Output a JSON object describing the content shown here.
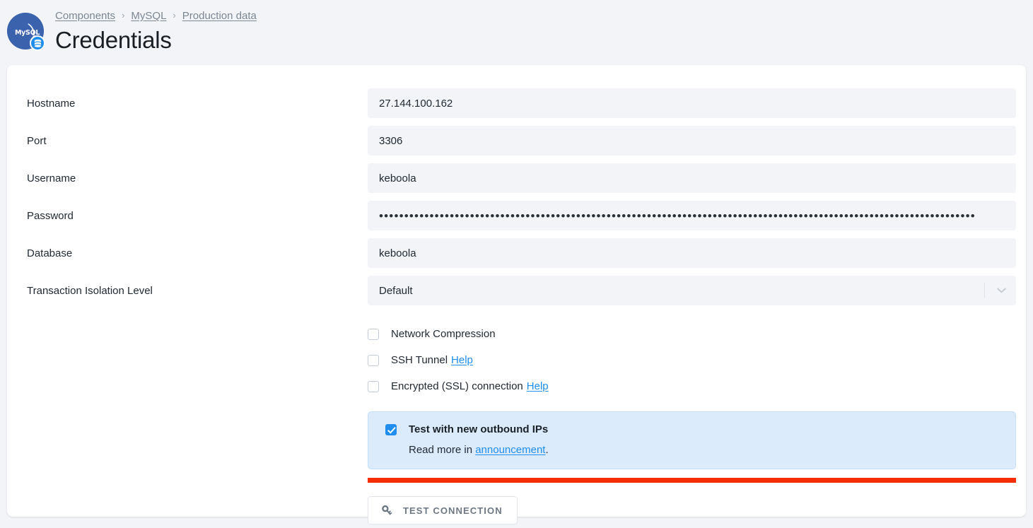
{
  "header": {
    "logo_icon": "mysql-logo-icon",
    "logo_text": "MySQL",
    "logo_badge_icon": "database-badge-icon",
    "breadcrumb": [
      {
        "label": "Components"
      },
      {
        "label": "MySQL"
      },
      {
        "label": "Production data"
      }
    ],
    "breadcrumb_separator": "›",
    "title": "Credentials"
  },
  "form": {
    "fields": [
      {
        "label": "Hostname",
        "value": "27.144.100.162",
        "type": "text"
      },
      {
        "label": "Port",
        "value": "3306",
        "type": "text"
      },
      {
        "label": "Username",
        "value": "keboola",
        "type": "text"
      },
      {
        "label": "Password",
        "value": "••••••••••••••••••••••••••••••••••••••••••••••••••••••••••••••••••••••••••••••••••••••••••••••••••••••••••••••••••••••",
        "type": "password"
      },
      {
        "label": "Database",
        "value": "keboola",
        "type": "text"
      }
    ],
    "isolation": {
      "label": "Transaction Isolation Level",
      "value": "Default",
      "chevron_icon": "chevron-down-icon"
    },
    "checkboxes": [
      {
        "label": "Network Compression",
        "checked": false,
        "help": null
      },
      {
        "label": "SSH Tunnel",
        "checked": false,
        "help": "Help"
      },
      {
        "label": "Encrypted (SSL) connection",
        "checked": false,
        "help": "Help"
      }
    ],
    "info_box": {
      "checked": true,
      "title": "Test with new outbound IPs",
      "sub_prefix": "Read more in ",
      "sub_link": "announcement",
      "sub_suffix": "."
    },
    "error_bar_color": "#f62e06",
    "test_button": {
      "label": "Test Connection",
      "icon": "key-icon"
    }
  },
  "colors": {
    "accent": "#1f8ded",
    "page_bg": "#f2f4f7",
    "field_bg": "#f2f4f7",
    "error": "#f62e06",
    "info_bg": "#dcebfb",
    "logo_blue": "#3b62ad"
  }
}
